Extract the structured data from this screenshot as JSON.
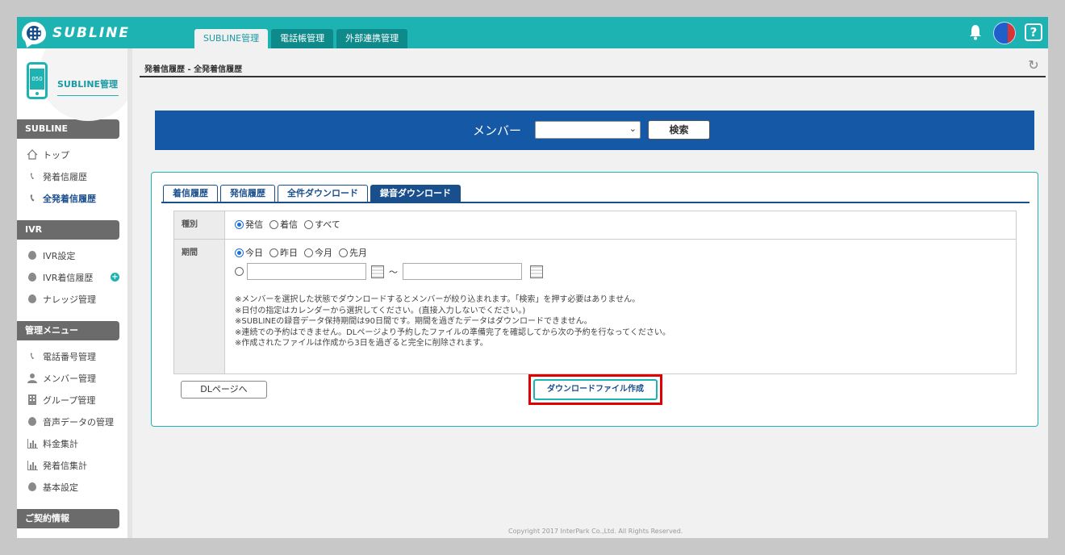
{
  "app": {
    "logo_text": "SUBLINE"
  },
  "header": {
    "tabs": [
      {
        "label": "SUBLINE管理",
        "active": true
      },
      {
        "label": "電話帳管理",
        "active": false
      },
      {
        "label": "外部連携管理",
        "active": false
      }
    ],
    "help_label": "?"
  },
  "sidebar": {
    "phone_label": "050",
    "title": "SUBLINE管理",
    "sections": [
      {
        "header": "SUBLINE",
        "items": [
          {
            "label": "トップ",
            "icon": "home-icon"
          },
          {
            "label": "発着信履歴",
            "icon": "phone-icon"
          },
          {
            "label": "全発着信履歴",
            "icon": "phone-icon",
            "active": true
          }
        ]
      },
      {
        "header": "IVR",
        "items": [
          {
            "label": "IVR設定",
            "icon": "bubble-icon"
          },
          {
            "label": "IVR着信履歴",
            "icon": "bubble-icon",
            "badge": "+"
          },
          {
            "label": "ナレッジ管理",
            "icon": "bubble-icon"
          }
        ]
      },
      {
        "header": "管理メニュー",
        "items": [
          {
            "label": "電話番号管理",
            "icon": "phone-icon"
          },
          {
            "label": "メンバー管理",
            "icon": "user-icon"
          },
          {
            "label": "グループ管理",
            "icon": "building-icon"
          },
          {
            "label": "音声データの管理",
            "icon": "bubble-icon"
          },
          {
            "label": "料金集計",
            "icon": "bar-chart-icon"
          },
          {
            "label": "発着信集計",
            "icon": "bar-chart-icon"
          },
          {
            "label": "基本設定",
            "icon": "bubble-icon"
          }
        ]
      },
      {
        "header": "ご契約情報",
        "items": []
      }
    ]
  },
  "main": {
    "breadcrumb": "発着信履歴 - 全発着信履歴",
    "member_label": "メンバー",
    "member_select_value": "",
    "search_label": "検索",
    "tabs": [
      {
        "label": "着信履歴",
        "active": false
      },
      {
        "label": "発信履歴",
        "active": false
      },
      {
        "label": "全件ダウンロード",
        "active": false
      },
      {
        "label": "録音ダウンロード",
        "active": true
      }
    ],
    "form": {
      "type_label": "種別",
      "type_options": [
        {
          "label": "発信",
          "checked": true
        },
        {
          "label": "着信",
          "checked": false
        },
        {
          "label": "すべて",
          "checked": false
        }
      ],
      "period_label": "期間",
      "period_options": [
        {
          "label": "今日",
          "checked": true
        },
        {
          "label": "昨日",
          "checked": false
        },
        {
          "label": "今月",
          "checked": false
        },
        {
          "label": "先月",
          "checked": false
        }
      ],
      "range_separator": "～",
      "date_from": "",
      "date_to": "",
      "notes": [
        "※メンバーを選択した状態でダウンロードするとメンバーが絞り込まれます。「検索」を押す必要はありません。",
        "※日付の指定はカレンダーから選択してください。(直接入力しないでください。)",
        "※SUBLINEの録音データ保持期間は90日間です。期間を過ぎたデータはダウンロードできません。",
        "※連続での予約はできません。DLページより予約したファイルの準備完了を確認してから次の予約を行なってください。",
        "※作成されたファイルは作成から3日を過ぎると完全に削除されます。"
      ]
    },
    "dl_page_label": "DLページへ",
    "create_file_label": "ダウンロードファイル作成"
  },
  "footer": {
    "copyright": "Copyright 2017 InterPark Co.,Ltd. All Rights Reserved."
  },
  "colors": {
    "header": "#1eb3b3",
    "member_bar": "#1558a6",
    "tab_active": "#1a4f8e",
    "highlight": "#e00000"
  }
}
